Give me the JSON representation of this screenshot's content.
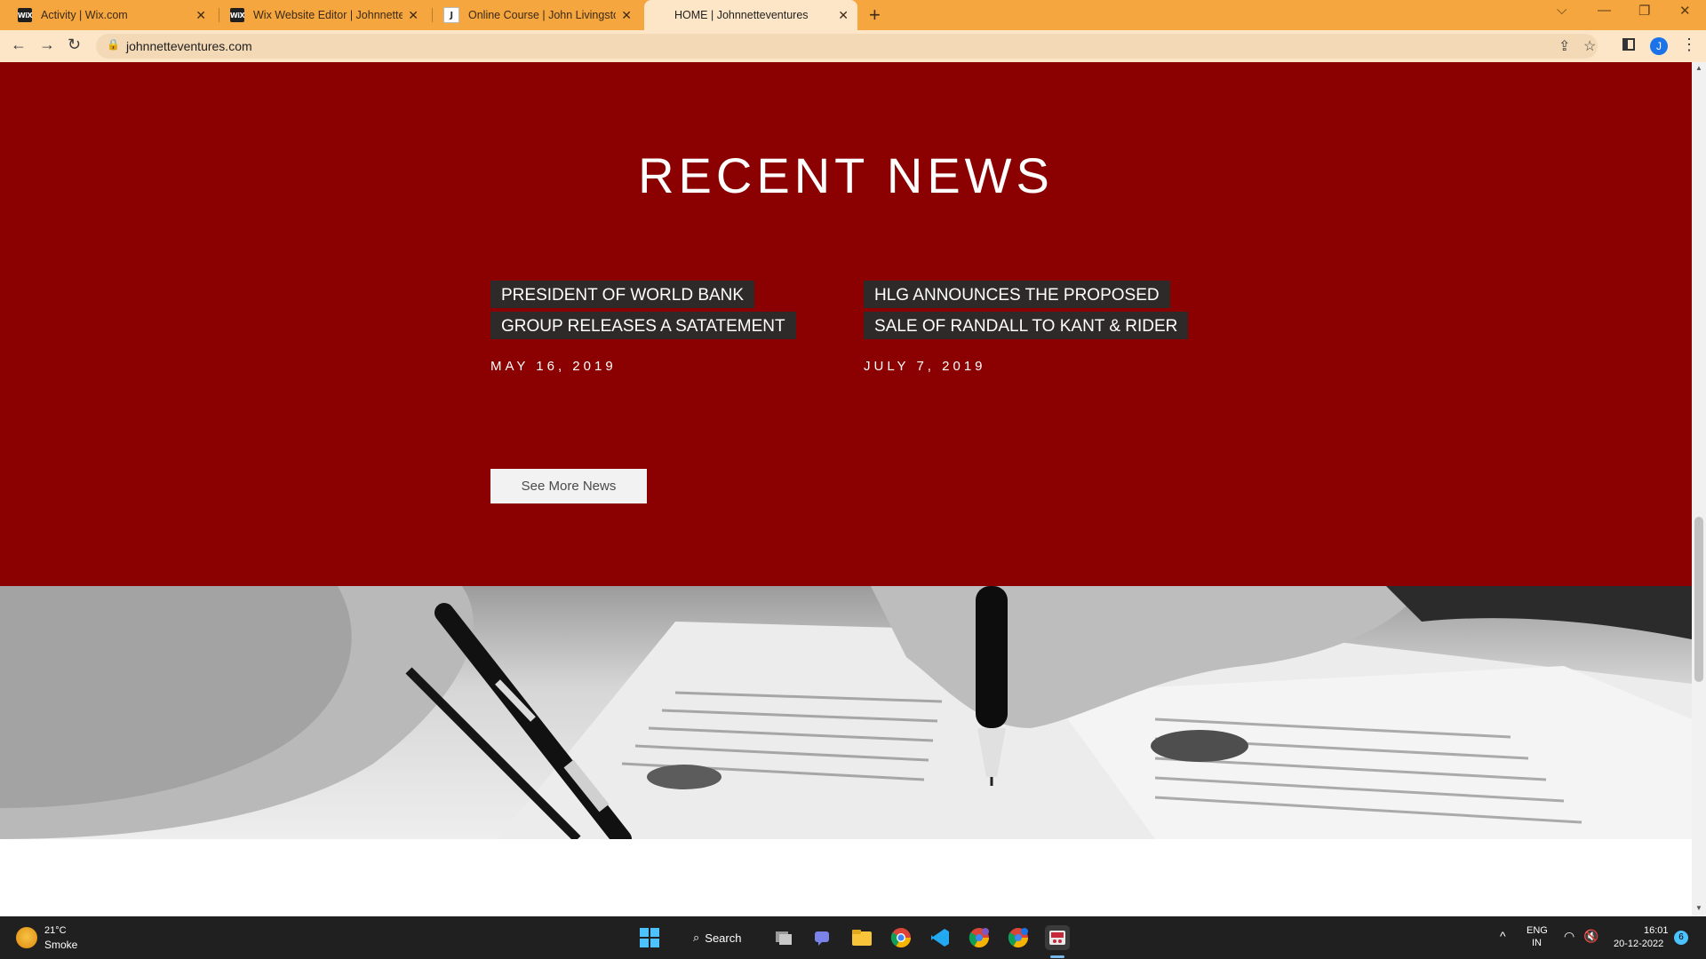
{
  "browser": {
    "tabs": [
      {
        "label": "Activity | Wix.com",
        "favicon": "WiX",
        "active": false
      },
      {
        "label": "Wix Website Editor | Johnnetteventures",
        "favicon": "WiX",
        "active": false
      },
      {
        "label": "Online Course | John Livingstone",
        "favicon": "J",
        "active": false
      },
      {
        "label": "HOME | Johnnetteventures",
        "favicon": "",
        "active": true
      }
    ],
    "new_tab_label": "+",
    "url": "johnnetteventures.com",
    "profile_initial": "J"
  },
  "news": {
    "title": "RECENT NEWS",
    "items": [
      {
        "headline_lines": [
          "PRESIDENT OF WORLD BANK",
          "GROUP RELEASES A SATATEMENT"
        ],
        "date": "MAY 16, 2019"
      },
      {
        "headline_lines": [
          "HLG ANNOUNCES THE PROPOSED",
          "SALE OF RANDALL TO KANT & RIDER"
        ],
        "date": "JULY 7, 2019"
      }
    ],
    "see_more_label": "See More News"
  },
  "taskbar": {
    "weather_temp": "21°C",
    "weather_desc": "Smoke",
    "search_label": "Search",
    "language_top": "ENG",
    "language_bottom": "IN",
    "time": "16:01",
    "date": "20-12-2022",
    "notification_count": "6"
  },
  "colors": {
    "tab_strip": "#f6a63f",
    "news_background": "#8b0000",
    "headline_background": "#2e2a2a",
    "taskbar": "#202020"
  }
}
